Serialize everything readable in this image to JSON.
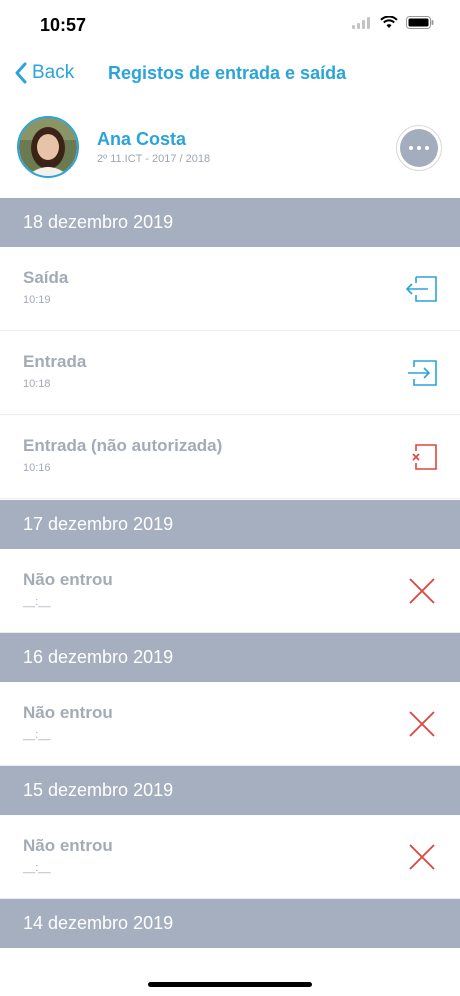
{
  "status": {
    "time": "10:57"
  },
  "nav": {
    "back_label": "Back",
    "title": "Registos de entrada e saída"
  },
  "profile": {
    "name": "Ana Costa",
    "class_info": "2º 11.ICT - 2017 / 2018"
  },
  "colors": {
    "accent": "#2aa4db",
    "header_bg": "#a5afbf",
    "exit_icon": "#2aa4db",
    "entry_icon": "#2aa4db",
    "denied_icon": "#e0443c",
    "muted_text": "#a4abb6"
  },
  "days": [
    {
      "date": "18 dezembro 2019",
      "records": [
        {
          "label": "Saída",
          "time": "10:19",
          "icon": "exit-icon"
        },
        {
          "label": "Entrada",
          "time": "10:18",
          "icon": "entry-icon"
        },
        {
          "label": "Entrada (não autorizada)",
          "time": "10:16",
          "icon": "entry-unauthorized-icon"
        }
      ]
    },
    {
      "date": "17 dezembro 2019",
      "records": [
        {
          "label": "Não entrou",
          "time": "__:__",
          "icon": "close-icon"
        }
      ]
    },
    {
      "date": "16 dezembro 2019",
      "records": [
        {
          "label": "Não entrou",
          "time": "__:__",
          "icon": "close-icon"
        }
      ]
    },
    {
      "date": "15 dezembro 2019",
      "records": [
        {
          "label": "Não entrou",
          "time": "__:__",
          "icon": "close-icon"
        }
      ]
    },
    {
      "date": "14 dezembro 2019",
      "records": []
    }
  ]
}
